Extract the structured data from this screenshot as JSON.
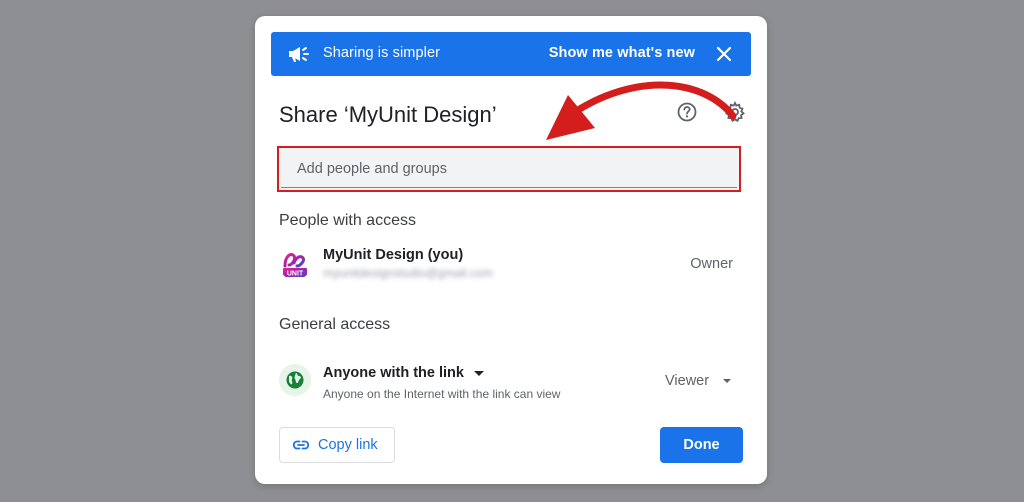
{
  "banner": {
    "text": "Sharing is simpler",
    "action_label": "Show me what's new",
    "icon": "megaphone-icon",
    "close_icon": "close-icon",
    "color": "#1a73e8"
  },
  "dialog": {
    "title": "Share ‘MyUnit Design’",
    "help_icon": "help-icon",
    "settings_icon": "gear-icon"
  },
  "add_people": {
    "placeholder": "Add people and groups",
    "value": ""
  },
  "people_with_access": {
    "heading": "People with access",
    "people": [
      {
        "name": "MyUnit Design (you)",
        "email": "myunitdesignstudio@gmail.com",
        "role": "Owner",
        "avatar_text": "UNIT"
      }
    ]
  },
  "general_access": {
    "heading": "General access",
    "link_setting": "Anyone with the link",
    "link_description": "Anyone on the Internet with the link can view",
    "role": "Viewer",
    "icon": "globe-icon"
  },
  "footer": {
    "copy_link_label": "Copy link",
    "done_label": "Done"
  },
  "annotation": {
    "color": "#d41e1e",
    "icon": "red-arrow-annotation"
  }
}
